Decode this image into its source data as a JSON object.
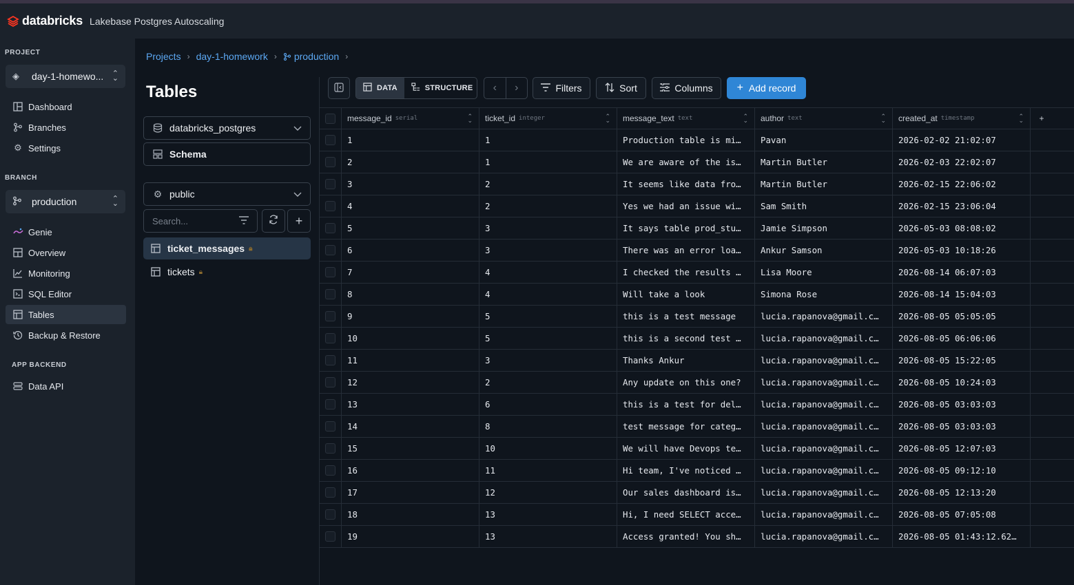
{
  "app": {
    "logo": "databricks",
    "title": "Lakebase Postgres Autoscaling"
  },
  "sidebar": {
    "project_label": "PROJECT",
    "project_value": "day-1-homewo...",
    "project_items": [
      {
        "label": "Dashboard",
        "icon": "dashboard-icon"
      },
      {
        "label": "Branches",
        "icon": "branch-icon"
      },
      {
        "label": "Settings",
        "icon": "gear-icon"
      }
    ],
    "branch_label": "BRANCH",
    "branch_value": "production",
    "branch_items": [
      {
        "label": "Genie",
        "icon": "genie-icon"
      },
      {
        "label": "Overview",
        "icon": "overview-icon"
      },
      {
        "label": "Monitoring",
        "icon": "chart-icon"
      },
      {
        "label": "SQL Editor",
        "icon": "sql-editor-icon"
      },
      {
        "label": "Tables",
        "icon": "table-icon",
        "active": true
      },
      {
        "label": "Backup & Restore",
        "icon": "history-icon"
      }
    ],
    "backend_label": "APP BACKEND",
    "backend_items": [
      {
        "label": "Data API",
        "icon": "api-icon"
      }
    ]
  },
  "breadcrumb": [
    "Projects",
    "day-1-homework",
    "production"
  ],
  "tables_panel": {
    "title": "Tables",
    "database": "databricks_postgres",
    "schema_label": "Schema",
    "schema_value": "public",
    "search_placeholder": "Search...",
    "tables": [
      {
        "name": "ticket_messages",
        "active": true
      },
      {
        "name": "tickets",
        "active": false
      }
    ]
  },
  "toolbar": {
    "data_tab": "DATA",
    "structure_tab": "STRUCTURE",
    "filters": "Filters",
    "sort": "Sort",
    "columns": "Columns",
    "add_record": "Add record"
  },
  "grid": {
    "columns": [
      {
        "name": "message_id",
        "type": "serial"
      },
      {
        "name": "ticket_id",
        "type": "integer"
      },
      {
        "name": "message_text",
        "type": "text"
      },
      {
        "name": "author",
        "type": "text"
      },
      {
        "name": "created_at",
        "type": "timestamp"
      }
    ],
    "rows": [
      [
        "1",
        "1",
        "Production table is mi…",
        "Pavan",
        "2026-02-02 21:02:07"
      ],
      [
        "2",
        "1",
        "We are aware of the is…",
        "Martin Butler",
        "2026-02-03 22:02:07"
      ],
      [
        "3",
        "2",
        "It seems like data fro…",
        "Martin Butler",
        "2026-02-15 22:06:02"
      ],
      [
        "4",
        "2",
        "Yes we had an issue wi…",
        "Sam Smith",
        "2026-02-15 23:06:04"
      ],
      [
        "5",
        "3",
        "It says table prod_stu…",
        "Jamie Simpson",
        "2026-05-03 08:08:02"
      ],
      [
        "6",
        "3",
        "There was an error loa…",
        "Ankur Samson",
        "2026-05-03 10:18:26"
      ],
      [
        "7",
        "4",
        "I checked the results …",
        "Lisa Moore",
        "2026-08-14 06:07:03"
      ],
      [
        "8",
        "4",
        "Will take a look",
        "Simona Rose",
        "2026-08-14 15:04:03"
      ],
      [
        "9",
        "5",
        "this is a test message",
        "lucia.rapanova@gmail.c…",
        "2026-08-05 05:05:05"
      ],
      [
        "10",
        "5",
        "this is a second test …",
        "lucia.rapanova@gmail.c…",
        "2026-08-05 06:06:06"
      ],
      [
        "11",
        "3",
        "Thanks Ankur",
        "lucia.rapanova@gmail.c…",
        "2026-08-05 15:22:05"
      ],
      [
        "12",
        "2",
        "Any update on this one?",
        "lucia.rapanova@gmail.c…",
        "2026-08-05 10:24:03"
      ],
      [
        "13",
        "6",
        "this is a test for del…",
        "lucia.rapanova@gmail.c…",
        "2026-08-05 03:03:03"
      ],
      [
        "14",
        "8",
        "test message for categ…",
        "lucia.rapanova@gmail.c…",
        "2026-08-05 03:03:03"
      ],
      [
        "15",
        "10",
        "We will have Devops te…",
        "lucia.rapanova@gmail.c…",
        "2026-08-05 12:07:03"
      ],
      [
        "16",
        "11",
        "Hi team, I've noticed …",
        "lucia.rapanova@gmail.c…",
        "2026-08-05 09:12:10"
      ],
      [
        "17",
        "12",
        "Our sales dashboard is…",
        "lucia.rapanova@gmail.c…",
        "2026-08-05 12:13:20"
      ],
      [
        "18",
        "13",
        "Hi, I need SELECT acce…",
        "lucia.rapanova@gmail.c…",
        "2026-08-05 07:05:08"
      ],
      [
        "19",
        "13",
        "Access granted! You sh…",
        "lucia.rapanova@gmail.c…",
        "2026-08-05 01:43:12.62…"
      ]
    ]
  },
  "colors": {
    "accent": "#2f86d6",
    "link": "#5ca8f3",
    "brand": "#ff3621"
  }
}
